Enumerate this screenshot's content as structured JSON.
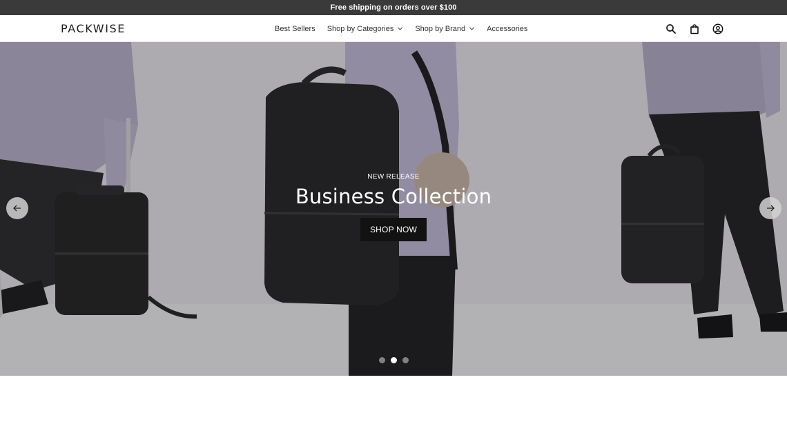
{
  "announcement": {
    "text": "Free shipping on orders over $100"
  },
  "header": {
    "logo": "PACKWISE",
    "nav": [
      {
        "label": "Best Sellers",
        "has_dropdown": false
      },
      {
        "label": "Shop by Categories",
        "has_dropdown": true
      },
      {
        "label": "Shop by Brand",
        "has_dropdown": true
      },
      {
        "label": "Accessories",
        "has_dropdown": false
      }
    ],
    "icons": [
      "search-icon",
      "shopping-bag-icon",
      "account-icon"
    ]
  },
  "hero": {
    "eyebrow": "NEW RELEASE",
    "title": "Business Collection",
    "cta_label": "SHOP NOW",
    "slides_total": 3,
    "active_slide": 2
  },
  "colors": {
    "announcement_bg": "#3a3a3a",
    "button_bg": "#121212",
    "hero_bg": "#cfcdd2"
  }
}
